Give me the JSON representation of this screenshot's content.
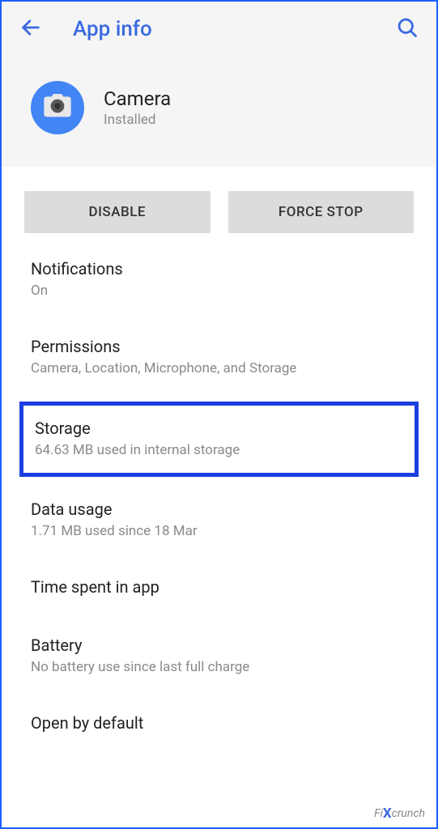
{
  "header": {
    "title": "App info"
  },
  "app": {
    "name": "Camera",
    "status": "Installed"
  },
  "buttons": {
    "disable": "DISABLE",
    "force_stop": "FORCE STOP"
  },
  "settings": {
    "notifications": {
      "title": "Notifications",
      "subtitle": "On"
    },
    "permissions": {
      "title": "Permissions",
      "subtitle": "Camera, Location, Microphone, and Storage"
    },
    "storage": {
      "title": "Storage",
      "subtitle": "64.63 MB used in internal storage"
    },
    "data_usage": {
      "title": "Data usage",
      "subtitle": "1.71 MB used since 18 Mar"
    },
    "time_spent": {
      "title": "Time spent in app",
      "subtitle": ""
    },
    "battery": {
      "title": "Battery",
      "subtitle": "No battery use since last full charge"
    },
    "open_default": {
      "title": "Open by default",
      "subtitle": ""
    }
  },
  "watermark": {
    "prefix": "Fi",
    "x": "X",
    "suffix": "crunch"
  }
}
